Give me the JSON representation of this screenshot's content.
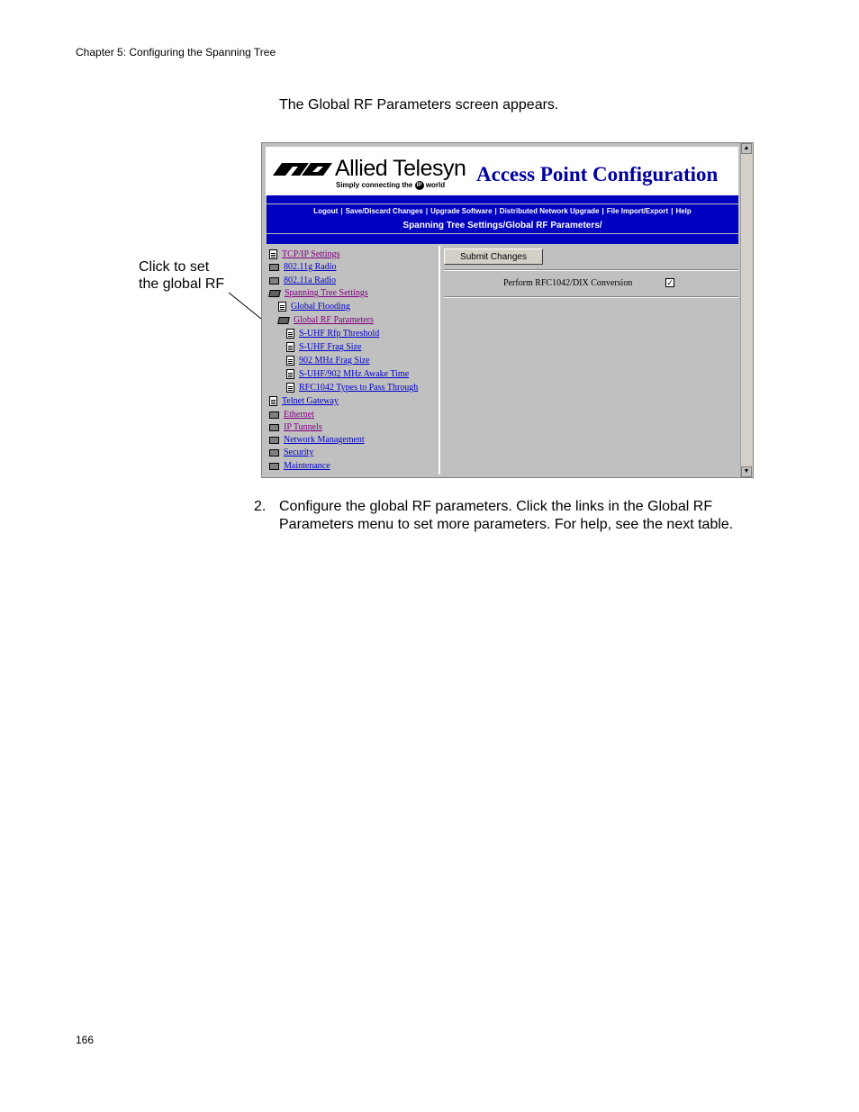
{
  "header": {
    "chapter": "Chapter 5: Configuring the Spanning Tree"
  },
  "intro": "The Global RF Parameters screen appears.",
  "callout": {
    "line1": "Click to set",
    "line2": "the global RF"
  },
  "screenshot": {
    "brand": "Allied Telesyn",
    "tagline_a": "Simply connecting the",
    "tagline_ip": "IP",
    "tagline_b": "world",
    "title": "Access Point Configuration",
    "nav": {
      "links": [
        "Logout",
        "Save/Discard Changes",
        "Upgrade Software",
        "Distributed Network Upgrade",
        "File Import/Export",
        "Help"
      ],
      "path": "Spanning Tree Settings/Global RF Parameters/"
    },
    "tree": [
      {
        "label": "TCP/IP Settings",
        "icon": "doc-icon"
      },
      {
        "label": "802.11g Radio",
        "icon": "folder-icon"
      },
      {
        "label": "802.11a Radio",
        "icon": "folder-icon"
      },
      {
        "label": "Spanning Tree Settings",
        "icon": "folder-open-icon"
      },
      {
        "label": "Global Flooding",
        "icon": "doc-icon"
      },
      {
        "label": "Global RF Parameters",
        "icon": "folder-open-icon"
      },
      {
        "label": "S-UHF Rfp Threshold",
        "icon": "doc-icon"
      },
      {
        "label": "S-UHF Frag Size",
        "icon": "doc-icon"
      },
      {
        "label": "902 MHz Frag Size",
        "icon": "doc-icon"
      },
      {
        "label": "S-UHF/902 MHz Awake Time",
        "icon": "doc-icon"
      },
      {
        "label": "RFC1042 Types to Pass Through",
        "icon": "doc-icon"
      },
      {
        "label": "Telnet Gateway",
        "icon": "doc-icon"
      },
      {
        "label": "Ethernet",
        "icon": "folder-icon"
      },
      {
        "label": "IP Tunnels",
        "icon": "folder-icon"
      },
      {
        "label": "Network Management",
        "icon": "folder-icon"
      },
      {
        "label": "Security",
        "icon": "folder-icon"
      },
      {
        "label": "Maintenance",
        "icon": "folder-icon"
      }
    ],
    "submit_label": "Submit Changes",
    "rfc_label": "Perform RFC1042/DIX Conversion",
    "rfc_checked": true
  },
  "step": {
    "number": "2.",
    "text": "Configure the global RF parameters. Click the links in the Global RF Parameters menu to set more parameters. For help, see the next table."
  },
  "page_number": "166"
}
